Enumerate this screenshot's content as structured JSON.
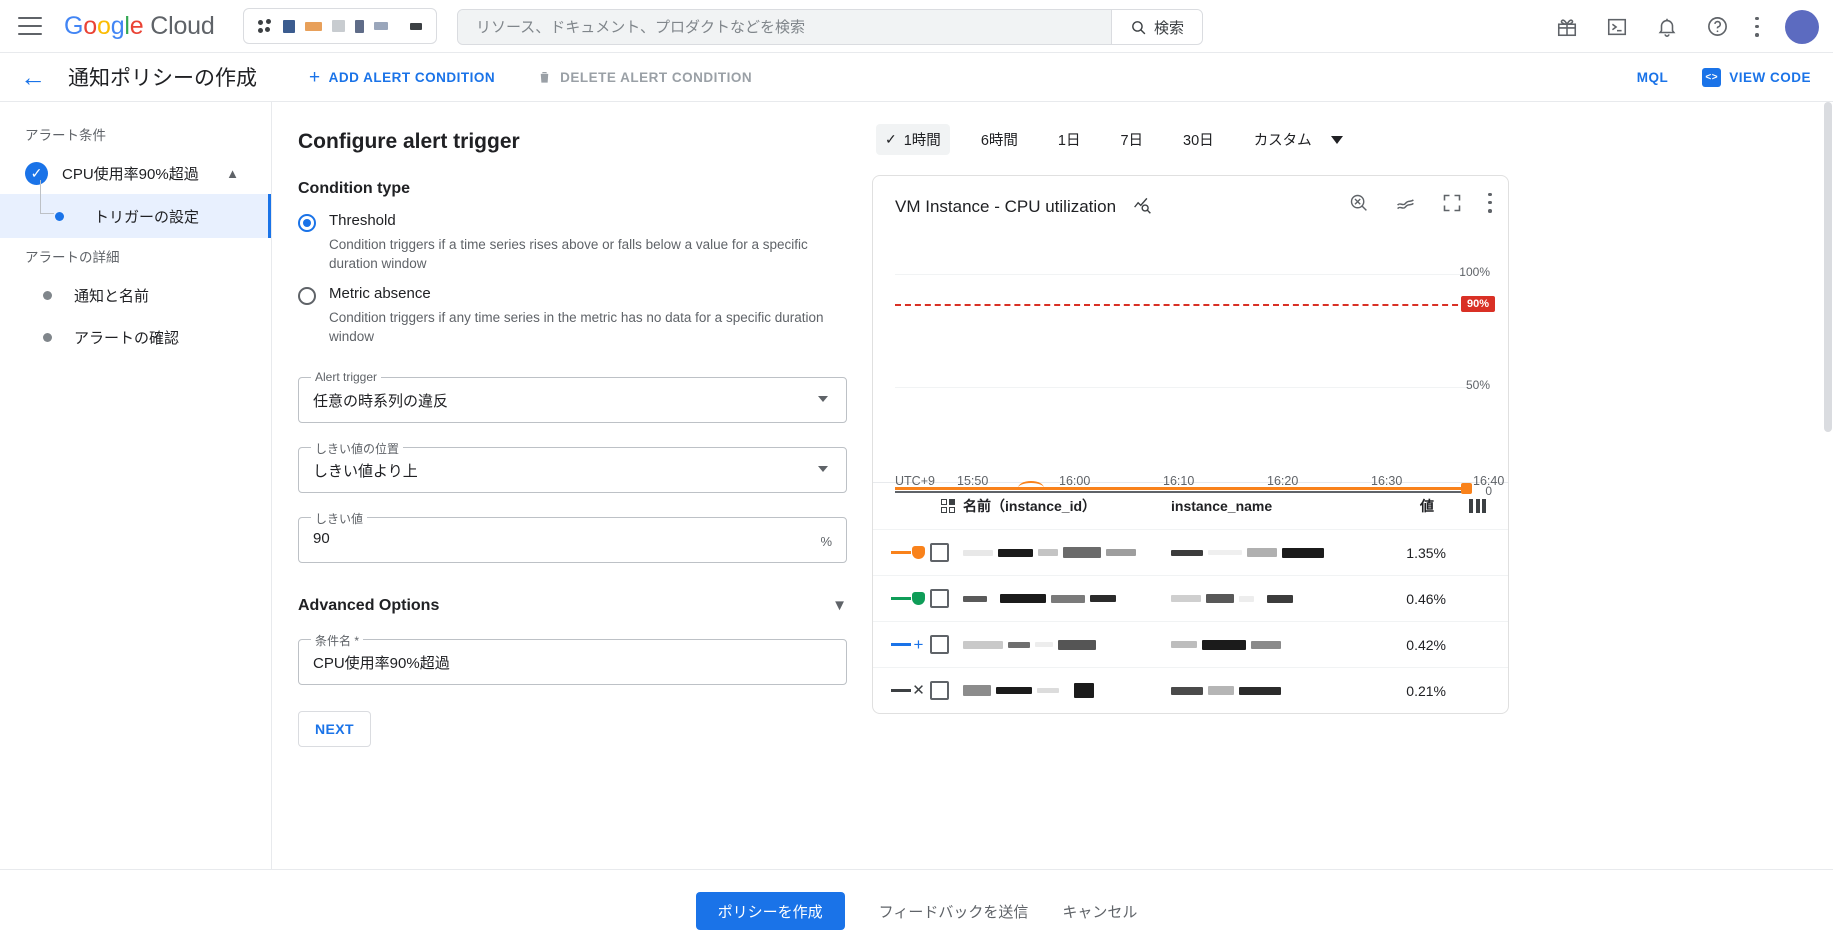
{
  "header": {
    "brand": {
      "g1": "G",
      "g2": "o",
      "g3": "o",
      "g4": "g",
      "g5": "l",
      "g6": "e",
      "cloud": "Cloud"
    },
    "project_selector_label": "",
    "search_placeholder": "リソース、ドキュメント、プロダクトなどを検索",
    "search_button": "検索",
    "icons": [
      "gift-icon",
      "cloud-shell-icon",
      "notifications-icon",
      "help-icon",
      "more-options-icon"
    ]
  },
  "toolbar": {
    "page_title": "通知ポリシーの作成",
    "add_alert_condition": "ADD ALERT CONDITION",
    "delete_alert_condition": "DELETE ALERT CONDITION",
    "mql": "MQL",
    "view_code": "VIEW CODE"
  },
  "sidebar": {
    "section_condition": "アラート条件",
    "condition_item": "CPU使用率90%超過",
    "sub_item": "トリガーの設定",
    "section_details": "アラートの詳細",
    "detail_items": [
      "通知と名前",
      "アラートの確認"
    ]
  },
  "form": {
    "title": "Configure alert trigger",
    "condition_type_label": "Condition type",
    "options": [
      {
        "label": "Threshold",
        "desc": "Condition triggers if a time series rises above or falls below a value for a specific duration window",
        "selected": true
      },
      {
        "label": "Metric absence",
        "desc": "Condition triggers if any time series in the metric has no data for a specific duration window",
        "selected": false
      }
    ],
    "alert_trigger": {
      "label": "Alert trigger",
      "value": "任意の時系列の違反"
    },
    "threshold_position": {
      "label": "しきい値の位置",
      "value": "しきい値より上"
    },
    "threshold_value": {
      "label": "しきい値",
      "value": "90",
      "unit": "%"
    },
    "advanced_options": "Advanced Options",
    "condition_name": {
      "label": "条件名 *",
      "value": "CPU使用率90%超過"
    },
    "next_button": "NEXT"
  },
  "chart_panel": {
    "time_ranges": [
      {
        "label": "1時間",
        "active": true
      },
      {
        "label": "6時間",
        "active": false
      },
      {
        "label": "1日",
        "active": false
      },
      {
        "label": "7日",
        "active": false
      },
      {
        "label": "30日",
        "active": false
      },
      {
        "label": "カスタム",
        "active": false
      }
    ],
    "card_title": "VM Instance - CPU utilization",
    "card_icons": [
      "zoom-reset-icon",
      "chart-style-icon",
      "fullscreen-icon",
      "chart-more-options-icon"
    ],
    "table": {
      "headers": {
        "name": "名前（instance_id）",
        "instance": "instance_name",
        "value": "値"
      },
      "rows": [
        {
          "value": "1.35%",
          "color": "#f9821b",
          "marker": "shield"
        },
        {
          "value": "0.46%",
          "color": "#0f9d58",
          "marker": "shield"
        },
        {
          "value": "0.42%",
          "color": "#1a73e8",
          "marker": "plus"
        },
        {
          "value": "0.21%",
          "color": "#3c4043",
          "marker": "cross"
        }
      ]
    }
  },
  "chart_data": {
    "type": "line",
    "title": "VM Instance - CPU utilization",
    "ylabel": "",
    "xlabel": "UTC+9",
    "timezone": "UTC+9",
    "ylim": [
      0,
      100
    ],
    "ytick_labels": [
      "100%",
      "50%",
      "0"
    ],
    "ytick_values": [
      100,
      50,
      0
    ],
    "xtick_labels": [
      "15:50",
      "16:00",
      "16:10",
      "16:20",
      "16:30",
      "16:40"
    ],
    "threshold": {
      "value": 90,
      "label": "90%",
      "color": "#d93025",
      "style": "dashed"
    },
    "grid": true,
    "legend_position": "table-below",
    "series": [
      {
        "name": "series-1",
        "color": "#f9821b",
        "latest_value": 1.35,
        "values": [
          1.3,
          1.3,
          1.35,
          1.4,
          2.0,
          1.4,
          1.35,
          1.3,
          1.35,
          1.3,
          1.35
        ]
      },
      {
        "name": "series-2",
        "color": "#0f9d58",
        "latest_value": 0.46,
        "values": [
          0.46,
          0.45,
          0.46,
          0.47,
          0.5,
          0.46,
          0.45,
          0.46,
          0.46,
          0.45,
          0.46
        ]
      },
      {
        "name": "series-3",
        "color": "#1a73e8",
        "latest_value": 0.42,
        "values": [
          0.42,
          0.42,
          0.41,
          0.43,
          0.44,
          0.42,
          0.42,
          0.41,
          0.42,
          0.42,
          0.42
        ]
      },
      {
        "name": "series-4",
        "color": "#3c4043",
        "latest_value": 0.21,
        "values": [
          0.21,
          0.2,
          0.21,
          0.22,
          0.21,
          0.21,
          0.2,
          0.21,
          0.21,
          0.21,
          0.21
        ]
      }
    ]
  },
  "bottom": {
    "create_policy": "ポリシーを作成",
    "send_feedback": "フィードバックを送信",
    "cancel": "キャンセル"
  }
}
